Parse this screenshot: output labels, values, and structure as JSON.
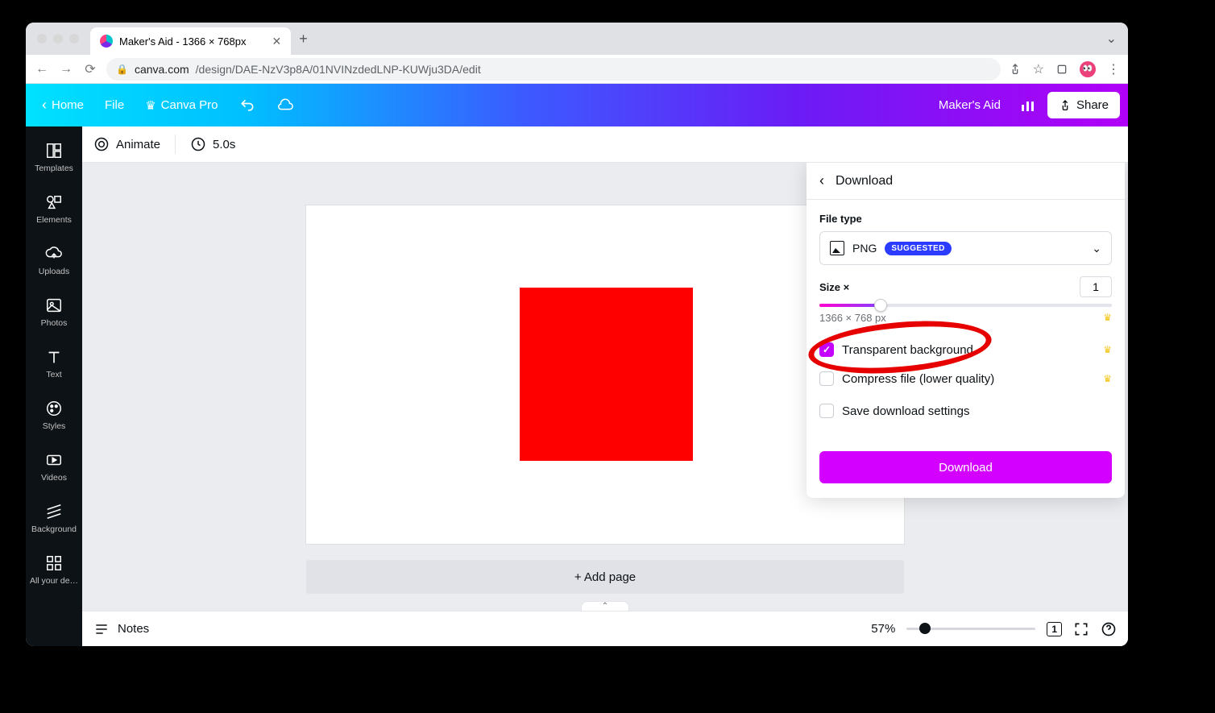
{
  "browser": {
    "tab_title": "Maker's Aid - 1366 × 768px",
    "url_domain": "canva.com",
    "url_path": "/design/DAE-NzV3p8A/01NVINzdedLNP-KUWju3DA/edit"
  },
  "topbar": {
    "home_label": "Home",
    "file_label": "File",
    "plan_label": "Canva Pro",
    "project_name": "Maker's Aid",
    "share_label": "Share"
  },
  "sidebar": {
    "items": [
      {
        "label": "Templates",
        "icon": "templates-icon"
      },
      {
        "label": "Elements",
        "icon": "elements-icon"
      },
      {
        "label": "Uploads",
        "icon": "uploads-icon"
      },
      {
        "label": "Photos",
        "icon": "photos-icon"
      },
      {
        "label": "Text",
        "icon": "text-icon"
      },
      {
        "label": "Styles",
        "icon": "styles-icon"
      },
      {
        "label": "Videos",
        "icon": "videos-icon"
      },
      {
        "label": "Background",
        "icon": "background-icon"
      },
      {
        "label": "All your de…",
        "icon": "designs-icon"
      }
    ]
  },
  "context_bar": {
    "animate_label": "Animate",
    "duration_label": "5.0s"
  },
  "canvas": {
    "add_page_label": "+ Add page"
  },
  "status_bar": {
    "notes_label": "Notes",
    "zoom_value": "57%",
    "page_count": "1"
  },
  "download_panel": {
    "title": "Download",
    "file_type_label": "File type",
    "file_type_value": "PNG",
    "suggested_badge": "SUGGESTED",
    "size_label": "Size ×",
    "size_value": "1",
    "dimensions_text": "1366 × 768 px",
    "transparent_bg_label": "Transparent background",
    "transparent_bg_checked": true,
    "compress_label": "Compress file (lower quality)",
    "compress_checked": false,
    "save_settings_label": "Save download settings",
    "save_settings_checked": false,
    "download_btn": "Download"
  }
}
